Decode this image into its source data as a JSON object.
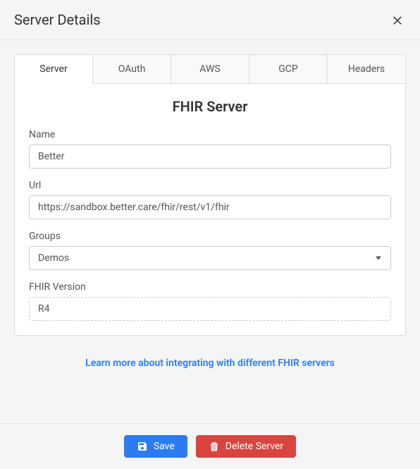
{
  "header": {
    "title": "Server Details"
  },
  "tabs": [
    {
      "label": "Server",
      "active": true
    },
    {
      "label": "OAuth",
      "active": false
    },
    {
      "label": "AWS",
      "active": false
    },
    {
      "label": "GCP",
      "active": false
    },
    {
      "label": "Headers",
      "active": false
    }
  ],
  "form": {
    "section_title": "FHIR Server",
    "name_label": "Name",
    "name_value": "Better",
    "url_label": "Url",
    "url_value": "https://sandbox.better.care/fhir/rest/v1/fhir",
    "groups_label": "Groups",
    "groups_value": "Demos",
    "version_label": "FHIR Version",
    "version_value": "R4"
  },
  "learn_more": "Learn more about integrating with different FHIR servers",
  "footer": {
    "save_label": "Save",
    "delete_label": "Delete Server"
  }
}
